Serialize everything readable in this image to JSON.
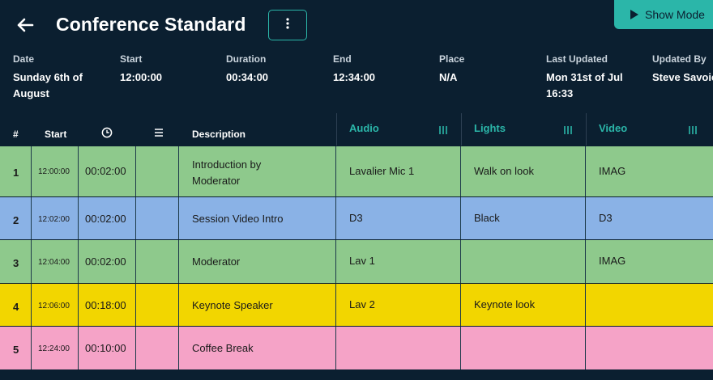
{
  "header": {
    "title": "Conference Standard",
    "show_mode_label": "Show Mode"
  },
  "meta": [
    {
      "label": "Date",
      "value_line1": "Sunday 6th of",
      "value_line2": "August"
    },
    {
      "label": "Start",
      "value_line1": "12:00:00",
      "value_line2": ""
    },
    {
      "label": "Duration",
      "value_line1": "00:34:00",
      "value_line2": ""
    },
    {
      "label": "End",
      "value_line1": "12:34:00",
      "value_line2": ""
    },
    {
      "label": "Place",
      "value_line1": "N/A",
      "value_line2": ""
    },
    {
      "label": "Last Updated",
      "value_line1": "Mon 31st of Jul",
      "value_line2": "16:33"
    },
    {
      "label": "Updated By",
      "value_line1": "Steve Savoie",
      "value_line2": ""
    }
  ],
  "columns": {
    "num": "#",
    "start": "Start",
    "description": "Description",
    "audio": "Audio",
    "lights": "Lights",
    "video": "Video"
  },
  "rows": [
    {
      "num": "1",
      "start": "12:00:00",
      "duration": "00:02:00",
      "description_line1": "Introduction by",
      "description_line2": "Moderator",
      "audio": "Lavalier Mic 1",
      "lights": "Walk on look",
      "video": "IMAG",
      "color": "#8ec98c"
    },
    {
      "num": "2",
      "start": "12:02:00",
      "duration": "00:02:00",
      "description_line1": "Session Video Intro",
      "description_line2": "",
      "audio": "D3",
      "lights": "Black",
      "video": "D3",
      "color": "#8ab2e6"
    },
    {
      "num": "3",
      "start": "12:04:00",
      "duration": "00:02:00",
      "description_line1": "Moderator",
      "description_line2": "",
      "audio": "Lav 1",
      "lights": "",
      "video": "IMAG",
      "color": "#8ec98c"
    },
    {
      "num": "4",
      "start": "12:06:00",
      "duration": "00:18:00",
      "description_line1": "Keynote Speaker",
      "description_line2": "",
      "audio": "Lav 2",
      "lights": "Keynote look",
      "video": "",
      "color": "#f2d600"
    },
    {
      "num": "5",
      "start": "12:24:00",
      "duration": "00:10:00",
      "description_line1": "Coffee Break",
      "description_line2": "",
      "audio": "",
      "lights": "",
      "video": "",
      "color": "#f5a3c7"
    }
  ],
  "colors": {
    "background": "#0b1f30",
    "accent": "#2bb6a9"
  }
}
